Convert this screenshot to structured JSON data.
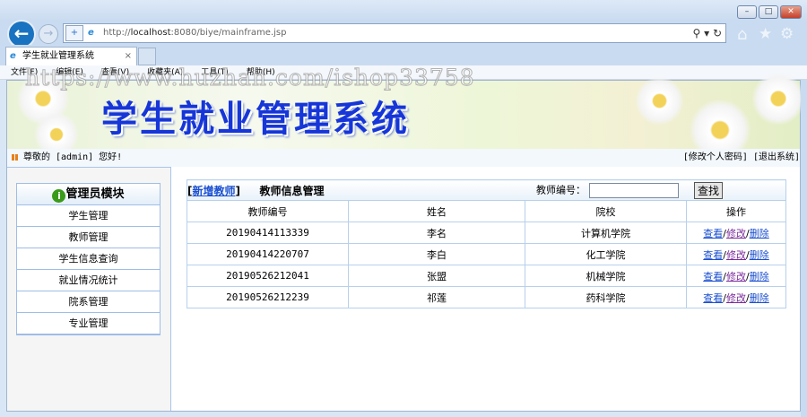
{
  "browser": {
    "url_prefix": "http://",
    "url_host": "localhost",
    "url_rest": ":8080/biye/mainframe.jsp",
    "tab_title": "学生就业管理系统",
    "menu": [
      "文件(F)",
      "编辑(E)",
      "查看(V)",
      "收藏夹(A)",
      "工具(T)",
      "帮助(H)"
    ]
  },
  "watermark": "https://www.huzhan.com/ishop33758",
  "banner": {
    "title": "学生就业管理系统"
  },
  "greeting": {
    "text": "尊敬的 [admin] 您好!",
    "change_password": "[修改个人密码]",
    "logout": "[退出系统]"
  },
  "sidebar": {
    "title": "管理员模块",
    "items": [
      "学生管理",
      "教师管理",
      "学生信息查询",
      "就业情况统计",
      "院系管理",
      "专业管理"
    ]
  },
  "main": {
    "add_label": "新增教师",
    "title": "教师信息管理",
    "search_label": "教师编号：",
    "search_value": "",
    "search_button": "查找",
    "columns": [
      "教师编号",
      "姓名",
      "院校",
      "操作"
    ],
    "rows": [
      {
        "id": "20190414113339",
        "name": "李名",
        "college": "计算机学院"
      },
      {
        "id": "20190414220707",
        "name": "李白",
        "college": "化工学院"
      },
      {
        "id": "20190526212041",
        "name": "张盟",
        "college": "机械学院"
      },
      {
        "id": "20190526212239",
        "name": "祁莲",
        "college": "药科学院"
      }
    ],
    "actions": {
      "view": "查看",
      "edit": "修改",
      "delete": "删除"
    }
  }
}
